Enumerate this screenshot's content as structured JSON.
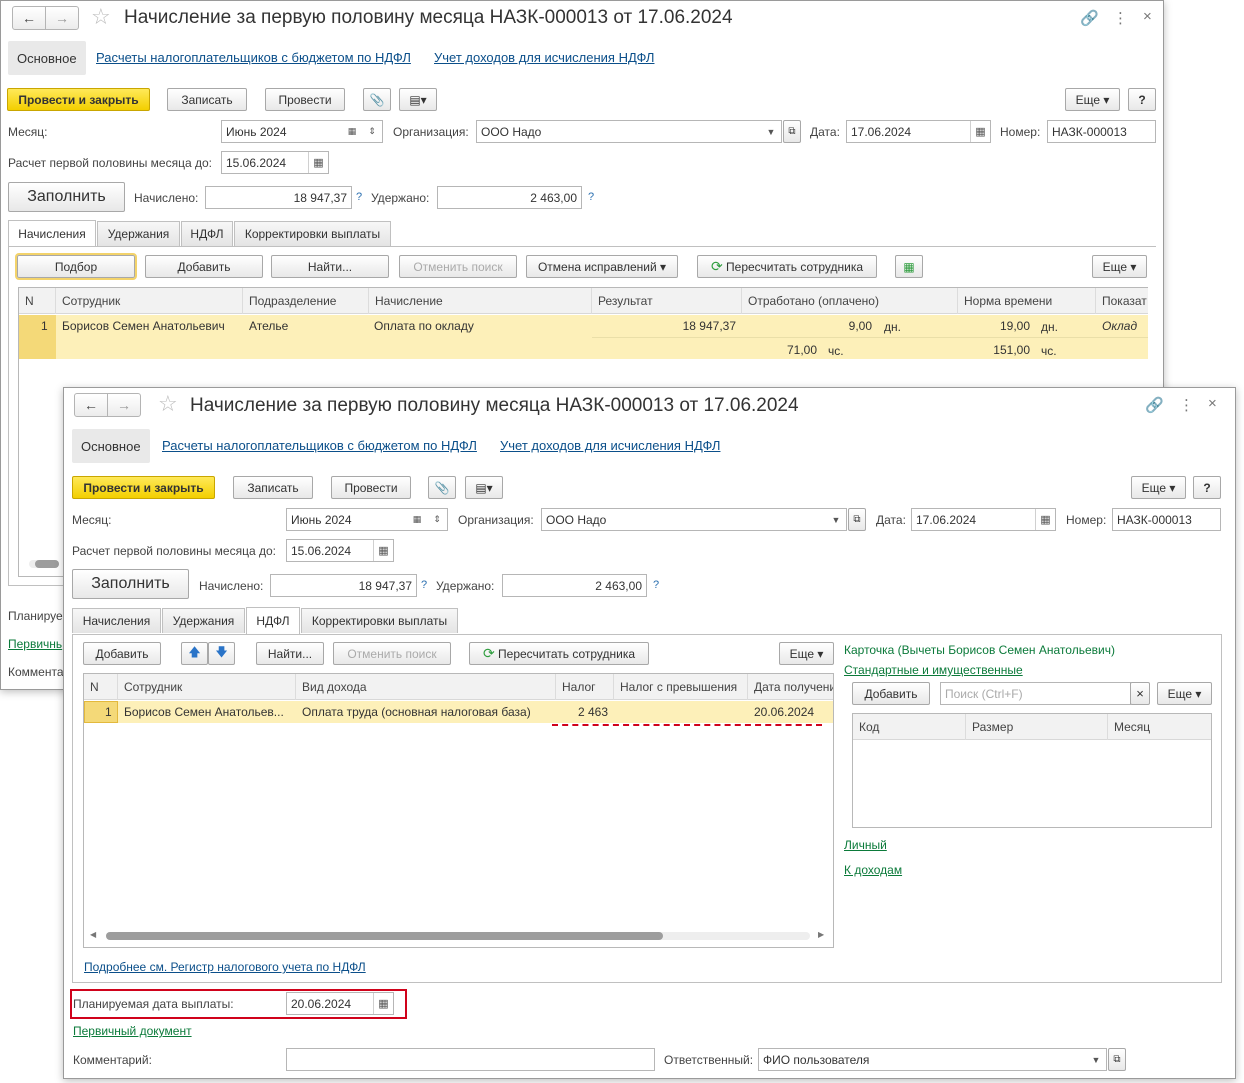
{
  "back": {
    "title": "Начисление за первую половину месяца НАЗК-000013 от 17.06.2024",
    "nav": {
      "main": "Основное",
      "link1": "Расчеты налогоплательщиков с бюджетом по НДФЛ",
      "link2": "Учет доходов для исчисления НДФЛ"
    },
    "toolbar": {
      "post_close": "Провести и закрыть",
      "save": "Записать",
      "post": "Провести",
      "more": "Еще",
      "help": "?"
    },
    "month_label": "Месяц:",
    "month": "Июнь 2024",
    "org_label": "Организация:",
    "org": "ООО Надо",
    "date_label": "Дата:",
    "date": "17.06.2024",
    "number_label": "Номер:",
    "number": "НАЗК-000013",
    "calc_label": "Расчет первой половины месяца до:",
    "calc_date": "15.06.2024",
    "fill": "Заполнить",
    "accrued_label": "Начислено:",
    "accrued": "18 947,37",
    "withheld_label": "Удержано:",
    "withheld": "2 463,00",
    "tabs": [
      "Начисления",
      "Удержания",
      "НДФЛ",
      "Корректировки выплаты"
    ],
    "grid_toolbar": {
      "pick": "Подбор",
      "add": "Добавить",
      "find": "Найти...",
      "cancel_search": "Отменить поиск",
      "cancel_fix": "Отмена исправлений",
      "recalc": "Пересчитать сотрудника",
      "more": "Еще"
    },
    "columns": [
      "N",
      "Сотрудник",
      "Подразделение",
      "Начисление",
      "Результат",
      "Отработано (оплачено)",
      "Норма времени",
      "Показат"
    ],
    "row": {
      "n": "1",
      "employee": "Борисов Семен Анатольевич",
      "dept": "Ателье",
      "accrual": "Оплата по окладу",
      "result": "18 947,37",
      "worked_days": "9,00",
      "days_unit": "дн.",
      "norm_days": "19,00",
      "norm_days_unit": "дн.",
      "indicator": "Оклад",
      "worked_hours": "71,00",
      "hours_unit": "чс.",
      "norm_hours": "151,00",
      "norm_hours_unit": "чс."
    },
    "planned_stub": "Планируе",
    "primary_stub": "Первичнь",
    "comment_stub": "Коммента"
  },
  "front": {
    "title": "Начисление за первую половину месяца НАЗК-000013 от 17.06.2024",
    "nav": {
      "main": "Основное",
      "link1": "Расчеты налогоплательщиков с бюджетом по НДФЛ",
      "link2": "Учет доходов для исчисления НДФЛ"
    },
    "toolbar": {
      "post_close": "Провести и закрыть",
      "save": "Записать",
      "post": "Провести",
      "more": "Еще",
      "help": "?"
    },
    "month_label": "Месяц:",
    "month": "Июнь 2024",
    "org_label": "Организация:",
    "org": "ООО Надо",
    "date_label": "Дата:",
    "date": "17.06.2024",
    "number_label": "Номер:",
    "number": "НАЗК-000013",
    "calc_label": "Расчет первой половины месяца до:",
    "calc_date": "15.06.2024",
    "fill": "Заполнить",
    "accrued_label": "Начислено:",
    "accrued": "18 947,37",
    "withheld_label": "Удержано:",
    "withheld": "2 463,00",
    "tabs": [
      "Начисления",
      "Удержания",
      "НДФЛ",
      "Корректировки выплаты"
    ],
    "grid_toolbar": {
      "add": "Добавить",
      "find": "Найти...",
      "cancel_search": "Отменить поиск",
      "recalc": "Пересчитать сотрудника",
      "more": "Еще"
    },
    "columns": [
      "N",
      "Сотрудник",
      "Вид дохода",
      "Налог",
      "Налог с превышения",
      "Дата получени"
    ],
    "row": {
      "n": "1",
      "employee": "Борисов Семен Анатольев...",
      "income_type": "Оплата труда (основная налоговая база)",
      "tax": "2 463",
      "tax_excess": "",
      "date": "20.06.2024"
    },
    "register_link": "Подробнее см. Регистр налогового учета по НДФЛ",
    "card": {
      "title": "Карточка (Вычеты Борисов Семен Анатольевич)",
      "standard_link": "Стандартные и имущественные",
      "add": "Добавить",
      "search_placeholder": "Поиск (Ctrl+F)",
      "clear": "×",
      "more": "Еще",
      "columns": [
        "Код",
        "Размер",
        "Месяц"
      ],
      "personal_link": "Личный",
      "income_link": "К доходам"
    },
    "planned_label": "Планируемая дата выплаты:",
    "planned_date": "20.06.2024",
    "primary_link": "Первичный документ",
    "comment_label": "Комментарий:",
    "comment": "",
    "responsible_label": "Ответственный:",
    "responsible": "ФИО пользователя"
  },
  "colors": {
    "accent_yellow": "#f3cf00",
    "selection": "#fdf0b9",
    "link_green": "#0b7a3a",
    "link_blue": "#0b4f8a",
    "highlight_red": "#d0021b"
  }
}
